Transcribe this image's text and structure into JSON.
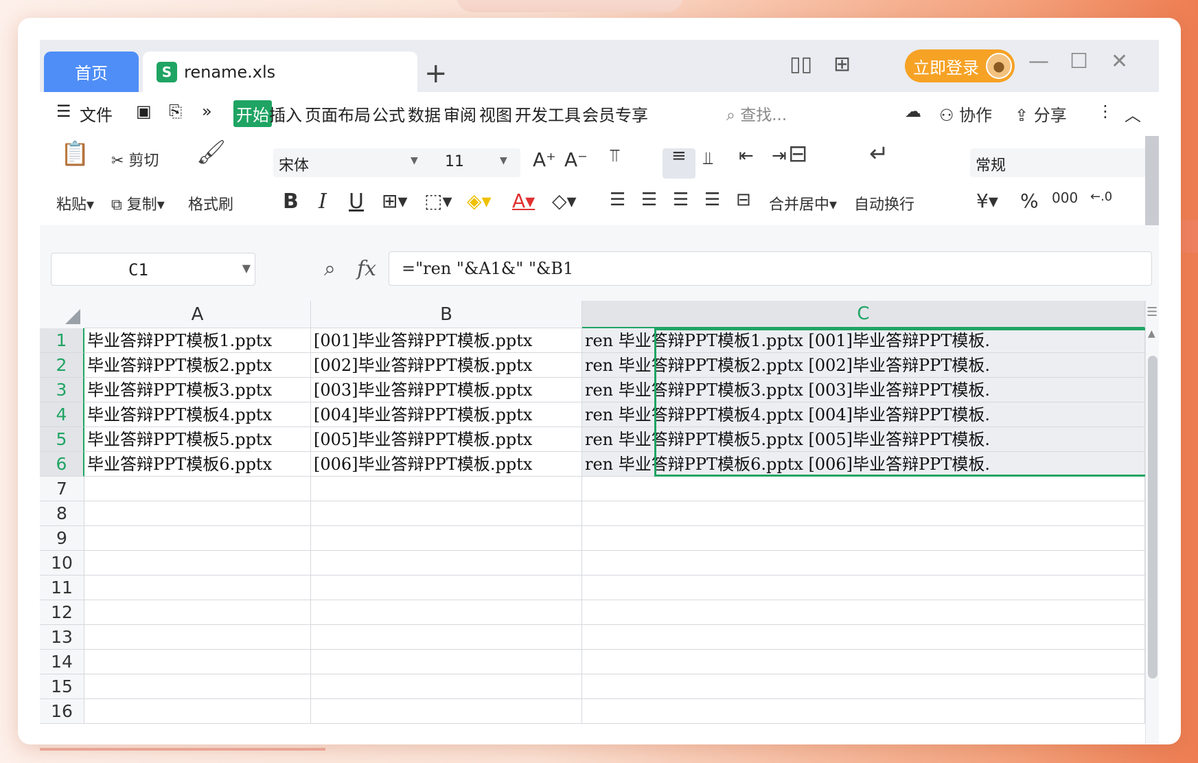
{
  "tabs": {
    "home": "首页",
    "file": "rename.xls",
    "file_icon": "S",
    "new": "+"
  },
  "account": {
    "login": "立即登录"
  },
  "menu": {
    "file": "文件",
    "items": [
      "开始",
      "插入",
      "页面布局",
      "公式",
      "数据",
      "审阅",
      "视图",
      "开发工具",
      "会员专享"
    ],
    "search": "查找...",
    "collab": "协作",
    "share": "分享"
  },
  "ribbon": {
    "paste": "粘贴",
    "cut": "剪切",
    "copy": "复制",
    "format_painter": "格式刷",
    "font_name": "宋体",
    "font_size": "11",
    "merge": "合并居中",
    "wrap": "自动换行",
    "number_format": "常规",
    "currency": "¥",
    "percent": "%",
    "thousands": "000"
  },
  "formula_bar": {
    "cell_ref": "C1",
    "fx": "fx",
    "formula": "=\"ren \"&A1&\" \"&B1"
  },
  "grid": {
    "columns": [
      "A",
      "B",
      "C"
    ],
    "selected_column": "C",
    "row_numbers": [
      "1",
      "2",
      "3",
      "4",
      "5",
      "6",
      "7",
      "8",
      "9",
      "10",
      "11",
      "12",
      "13",
      "14",
      "15",
      "16"
    ],
    "rows": [
      [
        "毕业答辩PPT模板1.pptx",
        "[001]毕业答辩PPT模板.pptx",
        "ren 毕业答辩PPT模板1.pptx [001]毕业答辩PPT模板."
      ],
      [
        "毕业答辩PPT模板2.pptx",
        "[002]毕业答辩PPT模板.pptx",
        "ren 毕业答辩PPT模板2.pptx [002]毕业答辩PPT模板."
      ],
      [
        "毕业答辩PPT模板3.pptx",
        "[003]毕业答辩PPT模板.pptx",
        "ren 毕业答辩PPT模板3.pptx [003]毕业答辩PPT模板."
      ],
      [
        "毕业答辩PPT模板4.pptx",
        "[004]毕业答辩PPT模板.pptx",
        "ren 毕业答辩PPT模板4.pptx [004]毕业答辩PPT模板."
      ],
      [
        "毕业答辩PPT模板5.pptx",
        "[005]毕业答辩PPT模板.pptx",
        "ren 毕业答辩PPT模板5.pptx [005]毕业答辩PPT模板."
      ],
      [
        "毕业答辩PPT模板6.pptx",
        "[006]毕业答辩PPT模板.pptx",
        "ren 毕业答辩PPT模板6.pptx [006]毕业答辩PPT模板."
      ]
    ]
  },
  "colors": {
    "accent": "#1fa463",
    "home_tab": "#4f8ef7",
    "login": "#f6a225"
  }
}
